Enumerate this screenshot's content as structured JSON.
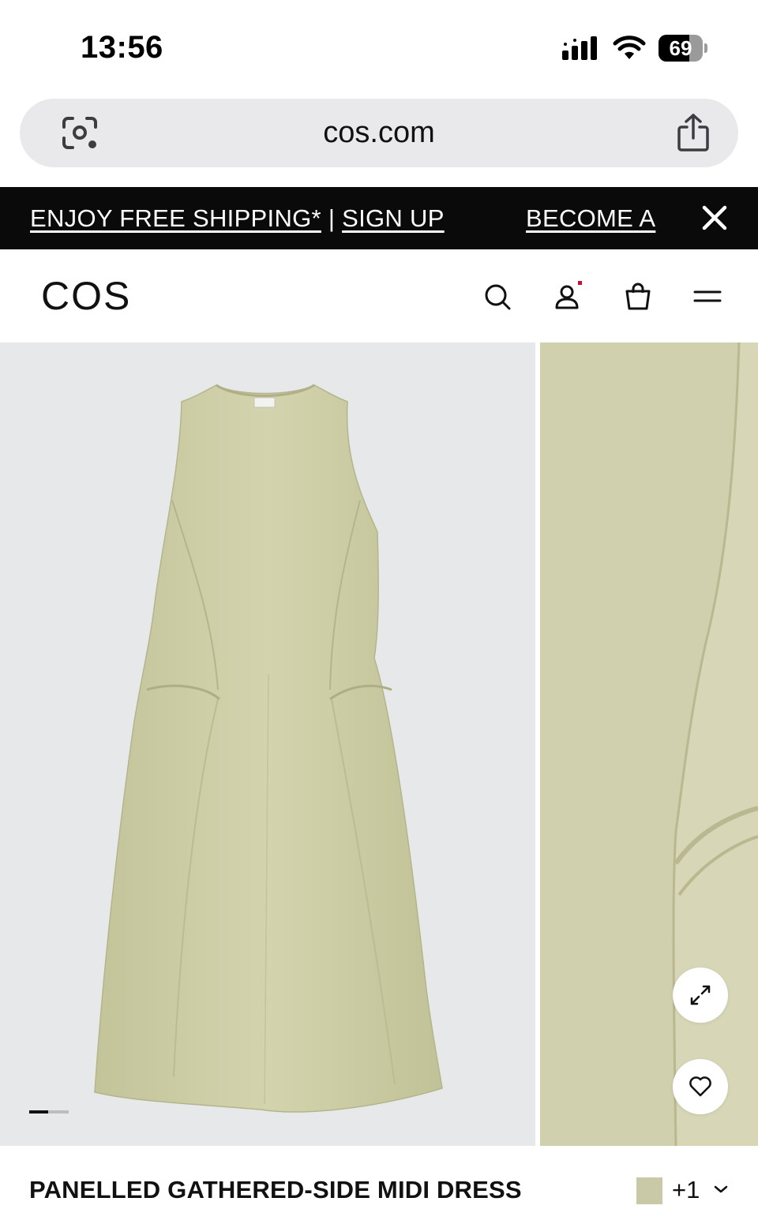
{
  "status_bar": {
    "time": "13:56",
    "battery_level": "69",
    "icons": [
      "signal-icon",
      "wifi-icon",
      "battery-icon"
    ]
  },
  "browser": {
    "url": "cos.com",
    "icons": [
      "lens-icon",
      "share-icon"
    ]
  },
  "promo": {
    "shipping_text": "ENJOY FREE SHIPPING*",
    "separator": "|",
    "signup_text": "SIGN UP",
    "secondary_text": "BECOME A",
    "close_icon": "close-icon"
  },
  "header": {
    "logo": "COS",
    "icons": [
      "search-icon",
      "account-icon",
      "bag-icon",
      "menu-icon"
    ],
    "notification_color": "#c8102e"
  },
  "gallery": {
    "image_position": 1,
    "dress_color": "#cccca4",
    "icons": [
      "expand-icon",
      "heart-icon"
    ]
  },
  "product": {
    "title": "PANELLED GATHERED-SIDE MIDI DRESS",
    "more_colors": "+1",
    "swatch_color": "#c9c9a8"
  }
}
